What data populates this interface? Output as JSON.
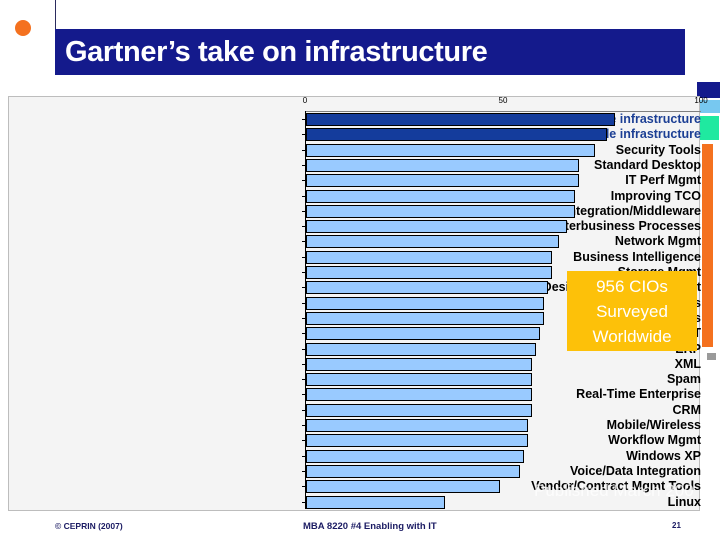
{
  "slide": {
    "title": "Gartner’s take on infrastructure",
    "footer_left": "© CEPRIN (2007)",
    "footer_center": "MBA 8220 #4 Enabling with IT",
    "page_number": "21"
  },
  "callout": {
    "line1": "956 CIOs",
    "line2": "Surveyed",
    "line3": "Worldwide",
    "background": "#fdc109",
    "text_color": "#ffffff"
  },
  "published_note": "Published March 200",
  "colors": {
    "title_bar": "#141a8c",
    "accent_orange": "#f4711f",
    "bar_default": "#99caff",
    "bar_highlight": "#143c9c",
    "label_highlight": "#1c3f94",
    "plot_background": "#f4f4f4",
    "deco_green": "#1fe9a0",
    "deco_light_blue": "#77c8f0",
    "deco_gray": "#9a9a9a"
  },
  "chart_data": {
    "type": "bar",
    "orientation": "horizontal",
    "title": "Gartner’s take on infrastructure",
    "xlabel": "",
    "ylabel": "",
    "xlim": [
      0,
      100
    ],
    "xticks": [
      0,
      50,
      100
    ],
    "xtick_labels": [
      "0",
      "50",
      "100"
    ],
    "grid": false,
    "legend": false,
    "categories": [
      "Developing efficient/flexible infrastructure",
      "Managing efficient/flexible infrastructure",
      "Security Tools",
      "Standard Desktop",
      "IT Perf Mgmt",
      "Improving TCO",
      "Integration/Middleware",
      "Interbusiness Processes",
      "Network Mgmt",
      "Business Intelligence",
      "Storage Mgmt",
      "Web Design/devt/Content Mgmt",
      "Enterprise Portals",
      "Web Services",
      "Legacy IT",
      "ERP",
      "XML",
      "Spam",
      "Real-Time Enterprise",
      "CRM",
      "Mobile/Wireless",
      "Workflow Mgmt",
      "Windows XP",
      "Voice/Data Integration",
      "Vendor/Contract Mgmt Tools",
      "Linux"
    ],
    "values": [
      78,
      76,
      73,
      69,
      69,
      68,
      68,
      66,
      64,
      62,
      62,
      61,
      60,
      60,
      59,
      58,
      57,
      57,
      57,
      57,
      56,
      56,
      55,
      54,
      49,
      35
    ],
    "highlighted_indices": [
      0,
      1
    ],
    "annotations": [
      "956 CIOs Surveyed Worldwide",
      "Published March 200"
    ]
  }
}
